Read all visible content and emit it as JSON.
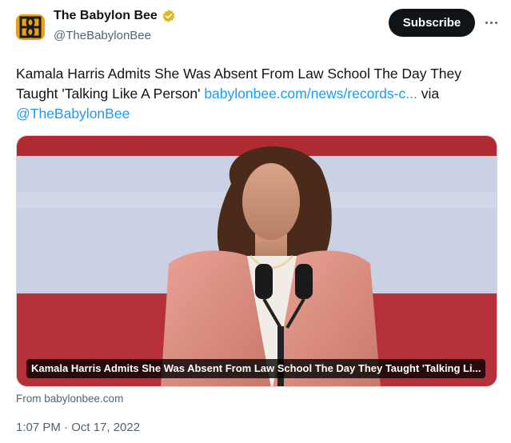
{
  "account": {
    "display_name": "The Babylon Bee",
    "handle": "@TheBabylonBee",
    "subscribe_label": "Subscribe",
    "logo_color": "#e8a11a",
    "verified_color": "#e2b719"
  },
  "tweet": {
    "text": "Kamala Harris Admits She Was Absent From Law School The Day They Taught 'Talking Like A Person' ",
    "link_text": "babylonbee.com/news/records-c...",
    "via_text": " via ",
    "mention": "@TheBabylonBee",
    "link_color": "#1d9bf0"
  },
  "card": {
    "caption": "Kamala Harris Admits She Was Absent From Law School The Day They Taught 'Talking Li...",
    "source": "From babylonbee.com"
  },
  "timestamp": "1:07 PM · Oct 17, 2022"
}
